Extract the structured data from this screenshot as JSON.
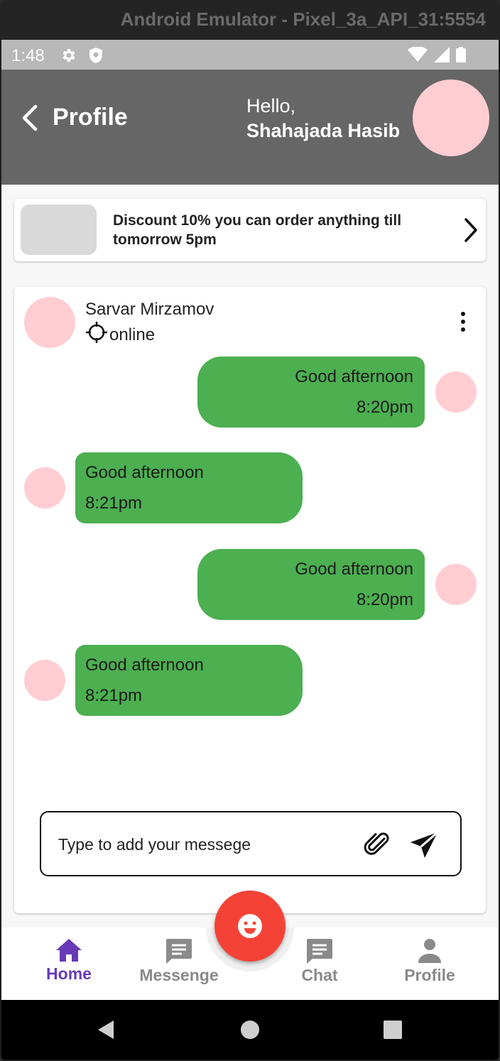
{
  "emulator": {
    "title": "Android Emulator - Pixel_3a_API_31:5554"
  },
  "status_bar": {
    "time": "1:48",
    "icons": [
      "gear-icon",
      "shield-icon",
      "wifi-icon",
      "signal-icon",
      "battery-icon"
    ]
  },
  "header": {
    "title": "Profile",
    "greeting": "Hello,",
    "user_name": "Shahajada Hasib",
    "bg_color": "#666666",
    "avatar_color": "#ffcdd2"
  },
  "banner": {
    "text": "Discount 10% you can order anything till tomorrow 5pm"
  },
  "chat": {
    "contact_name": "Sarvar Mirzamov",
    "contact_status": "online",
    "bubble_color": "#4caf50",
    "messages": [
      {
        "side": "sent",
        "text": "Good afternoon",
        "time": "8:20pm"
      },
      {
        "side": "received",
        "text": "Good afternoon",
        "time": "8:21pm"
      },
      {
        "side": "sent",
        "text": "Good afternoon",
        "time": "8:20pm"
      },
      {
        "side": "received",
        "text": "Good afternoon",
        "time": "8:21pm"
      }
    ],
    "input_placeholder": "Type to add your messege"
  },
  "bottom_nav": {
    "items": [
      {
        "label": "Home",
        "icon": "home-icon",
        "active": true
      },
      {
        "label": "Messenge",
        "icon": "message-icon",
        "active": false
      },
      {
        "label": "Chat",
        "icon": "chat-icon",
        "active": false
      },
      {
        "label": "Profile",
        "icon": "person-icon",
        "active": false
      }
    ],
    "active_color": "#673ab7",
    "inactive_color": "#8a8a8a",
    "fab_color": "#f44336",
    "fab_icon": "smiley-icon"
  },
  "system_nav": {
    "icons": [
      "back-triangle-icon",
      "home-circle-icon",
      "recents-square-icon"
    ]
  }
}
